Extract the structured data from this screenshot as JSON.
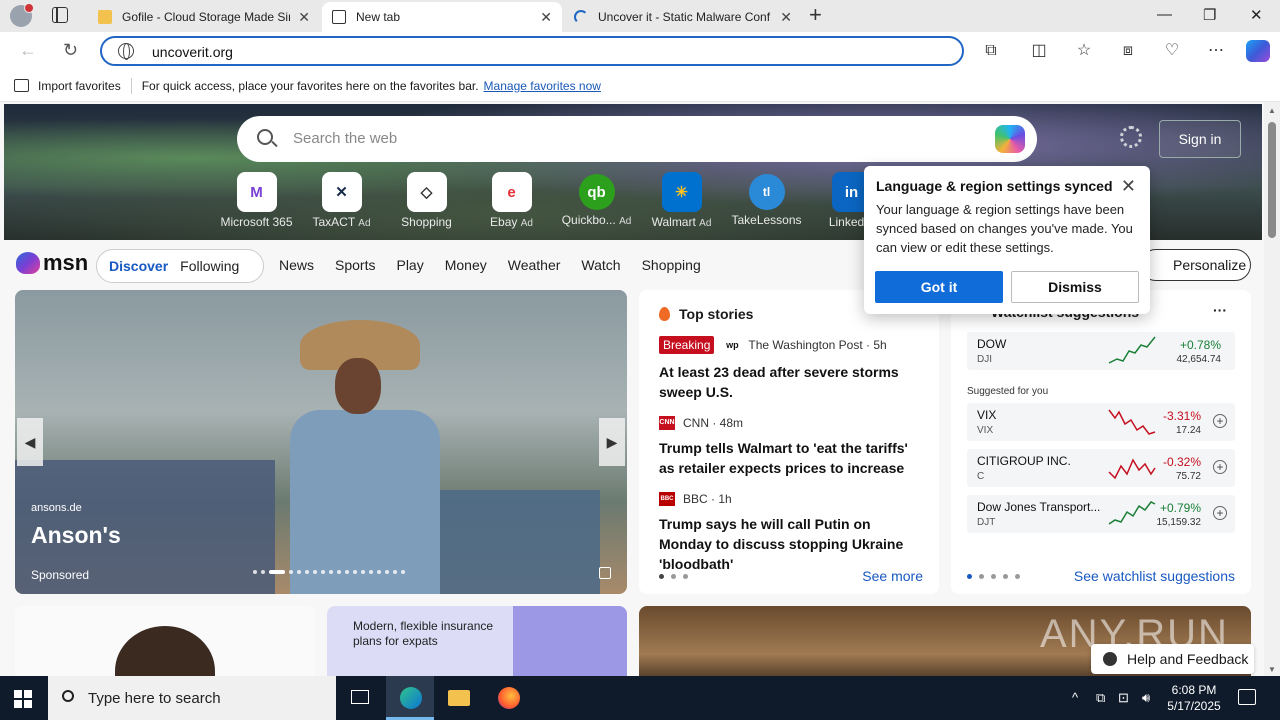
{
  "browser": {
    "tabs": [
      {
        "title": "Gofile - Cloud Storage Made Sim",
        "close": "✕"
      },
      {
        "title": "New tab",
        "close": "✕"
      },
      {
        "title": "Uncover it - Static Malware Conf",
        "close": "✕"
      }
    ],
    "new_tab_glyph": "+",
    "window_controls": {
      "minimize": "—",
      "restore": "❐",
      "close": "✕"
    },
    "address_value": "uncoverit.org",
    "favorites_bar": {
      "import_label": "Import favorites",
      "hint": "For quick access, place your favorites here on the favorites bar.",
      "manage_link": "Manage favorites now"
    }
  },
  "newtab": {
    "search_placeholder": "Search the web",
    "signin_label": "Sign in",
    "quick_links": [
      {
        "label": "Microsoft 365",
        "ad": "",
        "icon": "M"
      },
      {
        "label": "TaxACT",
        "ad": "Ad",
        "icon": "✕"
      },
      {
        "label": "Shopping",
        "ad": "",
        "icon": "◇"
      },
      {
        "label": "Ebay",
        "ad": "Ad",
        "icon": "e"
      },
      {
        "label": "Quickbo...",
        "ad": "Ad",
        "icon": "qb"
      },
      {
        "label": "Walmart",
        "ad": "Ad",
        "icon": "✳"
      },
      {
        "label": "TakeLessons",
        "ad": "",
        "icon": "tl"
      },
      {
        "label": "LinkedIn",
        "ad": "",
        "icon": "in"
      }
    ],
    "msn_logo": "msn",
    "pills": [
      "Discover",
      "Following"
    ],
    "categories": [
      "News",
      "Sports",
      "Play",
      "Money",
      "Weather",
      "Watch",
      "Shopping"
    ],
    "personalize_label": "Personalize"
  },
  "hero_card": {
    "source": "ansons.de",
    "headline": "Anson's",
    "sponsored": "Sponsored"
  },
  "top_stories": {
    "title": "Top stories",
    "items": [
      {
        "badge": "Breaking",
        "logo": "wp",
        "source": "The Washington Post · 5h",
        "headline": "At least 23 dead after severe storms sweep U.S."
      },
      {
        "badge": "",
        "logo": "CNN",
        "source": "CNN · 48m",
        "headline": "Trump tells Walmart to 'eat the tariffs' as retailer expects prices to increase"
      },
      {
        "badge": "",
        "logo": "BBC",
        "source": "BBC · 1h",
        "headline": "Trump says he will call Putin on Monday to discuss stopping Ukraine 'bloodbath'"
      }
    ],
    "see_more": "See more"
  },
  "watchlist": {
    "title": "Watchlist suggestions",
    "more": "···",
    "main": {
      "name": "DOW",
      "symbol": "DJI",
      "change": "+0.78%",
      "value": "42,654.74",
      "trend": "up"
    },
    "suggested_label": "Suggested for you",
    "suggested": [
      {
        "name": "VIX",
        "symbol": "VIX",
        "change": "-3.31%",
        "value": "17.24",
        "trend": "down"
      },
      {
        "name": "CITIGROUP INC.",
        "symbol": "C",
        "change": "-0.32%",
        "value": "75.72",
        "trend": "down"
      },
      {
        "name": "Dow Jones Transport...",
        "symbol": "DJT",
        "change": "+0.79%",
        "value": "15,159.32",
        "trend": "up"
      }
    ],
    "see_link": "See watchlist suggestions"
  },
  "promo_card": {
    "text": "Modern, flexible insurance plans for expats"
  },
  "watermark": "ANY.RUN",
  "feedback_label": "Help and Feedback",
  "popup": {
    "title": "Language & region settings synced",
    "body": "Your language & region settings have been synced based on changes you've made. You can view or edit these settings.",
    "primary": "Got it",
    "secondary": "Dismiss",
    "close": "✕"
  },
  "taskbar": {
    "search_placeholder": "Type here to search",
    "time": "6:08 PM",
    "date": "5/17/2025"
  },
  "colors": {
    "accent": "#0f6cd9",
    "address_border": "#2066c4",
    "taskbar": "#0f1b2b",
    "positive": "#1a7f37",
    "negative": "#c50f1f"
  }
}
